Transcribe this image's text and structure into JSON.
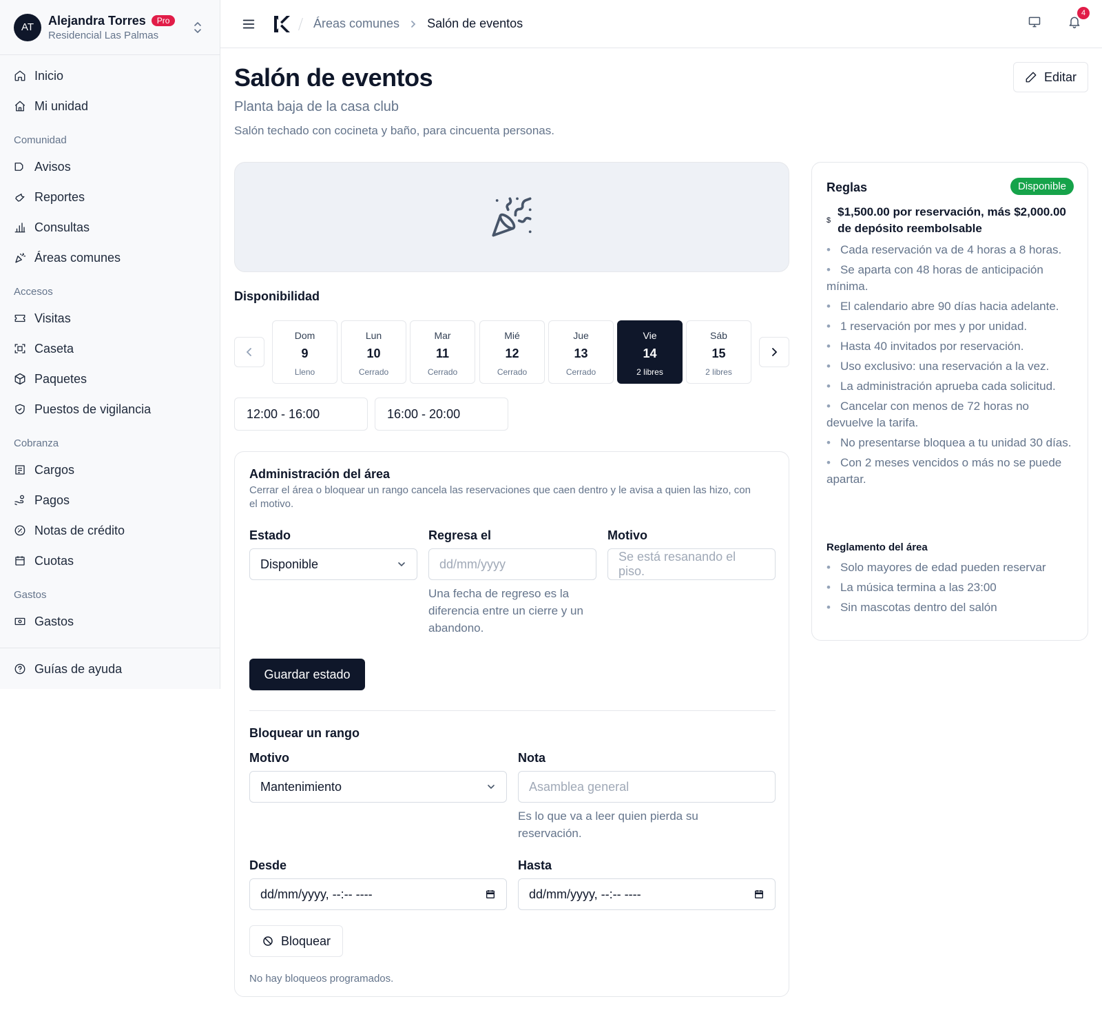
{
  "user": {
    "initials": "AT",
    "name": "Alejandra Torres",
    "badge": "Pro",
    "org": "Residencial Las Palmas"
  },
  "sidebar": {
    "top": [
      {
        "label": "Inicio",
        "icon": "home-icon"
      },
      {
        "label": "Mi unidad",
        "icon": "house-icon"
      }
    ],
    "sections": [
      {
        "title": "Comunidad",
        "items": [
          {
            "label": "Avisos",
            "icon": "megaphone-icon"
          },
          {
            "label": "Reportes",
            "icon": "wrench-icon"
          },
          {
            "label": "Consultas",
            "icon": "bar-chart-icon"
          },
          {
            "label": "Áreas comunes",
            "icon": "party-popper-icon"
          }
        ]
      },
      {
        "title": "Accesos",
        "items": [
          {
            "label": "Visitas",
            "icon": "ticket-icon"
          },
          {
            "label": "Caseta",
            "icon": "scan-icon"
          },
          {
            "label": "Paquetes",
            "icon": "package-icon"
          },
          {
            "label": "Puestos de vigilancia",
            "icon": "shield-icon"
          }
        ]
      },
      {
        "title": "Cobranza",
        "items": [
          {
            "label": "Cargos",
            "icon": "receipt-icon"
          },
          {
            "label": "Pagos",
            "icon": "hand-coins-icon"
          },
          {
            "label": "Notas de crédito",
            "icon": "badge-percent-icon"
          },
          {
            "label": "Cuotas",
            "icon": "calendar-icon"
          }
        ]
      },
      {
        "title": "Gastos",
        "items": [
          {
            "label": "Gastos",
            "icon": "banknote-icon"
          }
        ]
      }
    ],
    "footer": {
      "label": "Guías de ayuda",
      "icon": "help-circle-icon"
    }
  },
  "topbar": {
    "breadcrumb_parent": "Áreas comunes",
    "breadcrumb_current": "Salón de eventos",
    "notification_count": "4"
  },
  "page": {
    "title": "Salón de eventos",
    "subtitle": "Planta baja de la casa club",
    "description": "Salón techado con cocineta y baño, para cincuenta personas.",
    "edit_label": "Editar"
  },
  "availability": {
    "title": "Disponibilidad",
    "days": [
      {
        "name": "Dom",
        "date": "9",
        "status": "Lleno",
        "selected": false
      },
      {
        "name": "Lun",
        "date": "10",
        "status": "Cerrado",
        "selected": false
      },
      {
        "name": "Mar",
        "date": "11",
        "status": "Cerrado",
        "selected": false
      },
      {
        "name": "Mié",
        "date": "12",
        "status": "Cerrado",
        "selected": false
      },
      {
        "name": "Jue",
        "date": "13",
        "status": "Cerrado",
        "selected": false
      },
      {
        "name": "Vie",
        "date": "14",
        "status": "2 libres",
        "selected": true
      },
      {
        "name": "Sáb",
        "date": "15",
        "status": "2 libres",
        "selected": false
      }
    ],
    "slots": [
      "12:00 - 16:00",
      "16:00 - 20:00"
    ]
  },
  "admin": {
    "title": "Administración del área",
    "description": "Cerrar el área o bloquear un rango cancela las reservaciones que caen dentro y le avisa a quien las hizo, con el motivo.",
    "estado_label": "Estado",
    "estado_value": "Disponible",
    "regresa_label": "Regresa el",
    "regresa_placeholder": "dd/mm/yyyy",
    "regresa_help": "Una fecha de regreso es la diferencia entre un cierre y un abandono.",
    "motivo_label": "Motivo",
    "motivo_placeholder": "Se está resanando el piso.",
    "save_label": "Guardar estado",
    "block_title": "Bloquear un rango",
    "block_motivo_label": "Motivo",
    "block_motivo_value": "Mantenimiento",
    "nota_label": "Nota",
    "nota_placeholder": "Asamblea general",
    "nota_help": "Es lo que va a leer quien pierda su reservación.",
    "desde_label": "Desde",
    "desde_placeholder": "dd/mm/yyyy, --:-- ----",
    "hasta_label": "Hasta",
    "hasta_placeholder": "dd/mm/yyyy, --:-- ----",
    "block_button": "Bloquear",
    "empty_text": "No hay bloqueos programados."
  },
  "rules": {
    "title": "Reglas",
    "status": "Disponible",
    "status_color": "#16a34a",
    "price_symbol": "$",
    "price_text": "$1,500.00 por reservación, más $2,000.00 de depósito reembolsable",
    "items": [
      "Cada reservación va de 4 horas a 8 horas.",
      "Se aparta con 48 horas de anticipación mínima.",
      "El calendario abre 90 días hacia adelante.",
      "1 reservación por mes y por unidad.",
      "Hasta 40 invitados por reservación.",
      "Uso exclusivo: una reservación a la vez.",
      "La administración aprueba cada solicitud.",
      "Cancelar con menos de 72 horas no devuelve la tarifa.",
      "No presentarse bloquea a tu unidad 30 días.",
      "Con 2 meses vencidos o más no se puede apartar."
    ],
    "reglamento_title": "Reglamento del área",
    "reglamento_items": [
      "Solo mayores de edad pueden reservar",
      "La música termina a las 23:00",
      "Sin mascotas dentro del salón"
    ]
  }
}
